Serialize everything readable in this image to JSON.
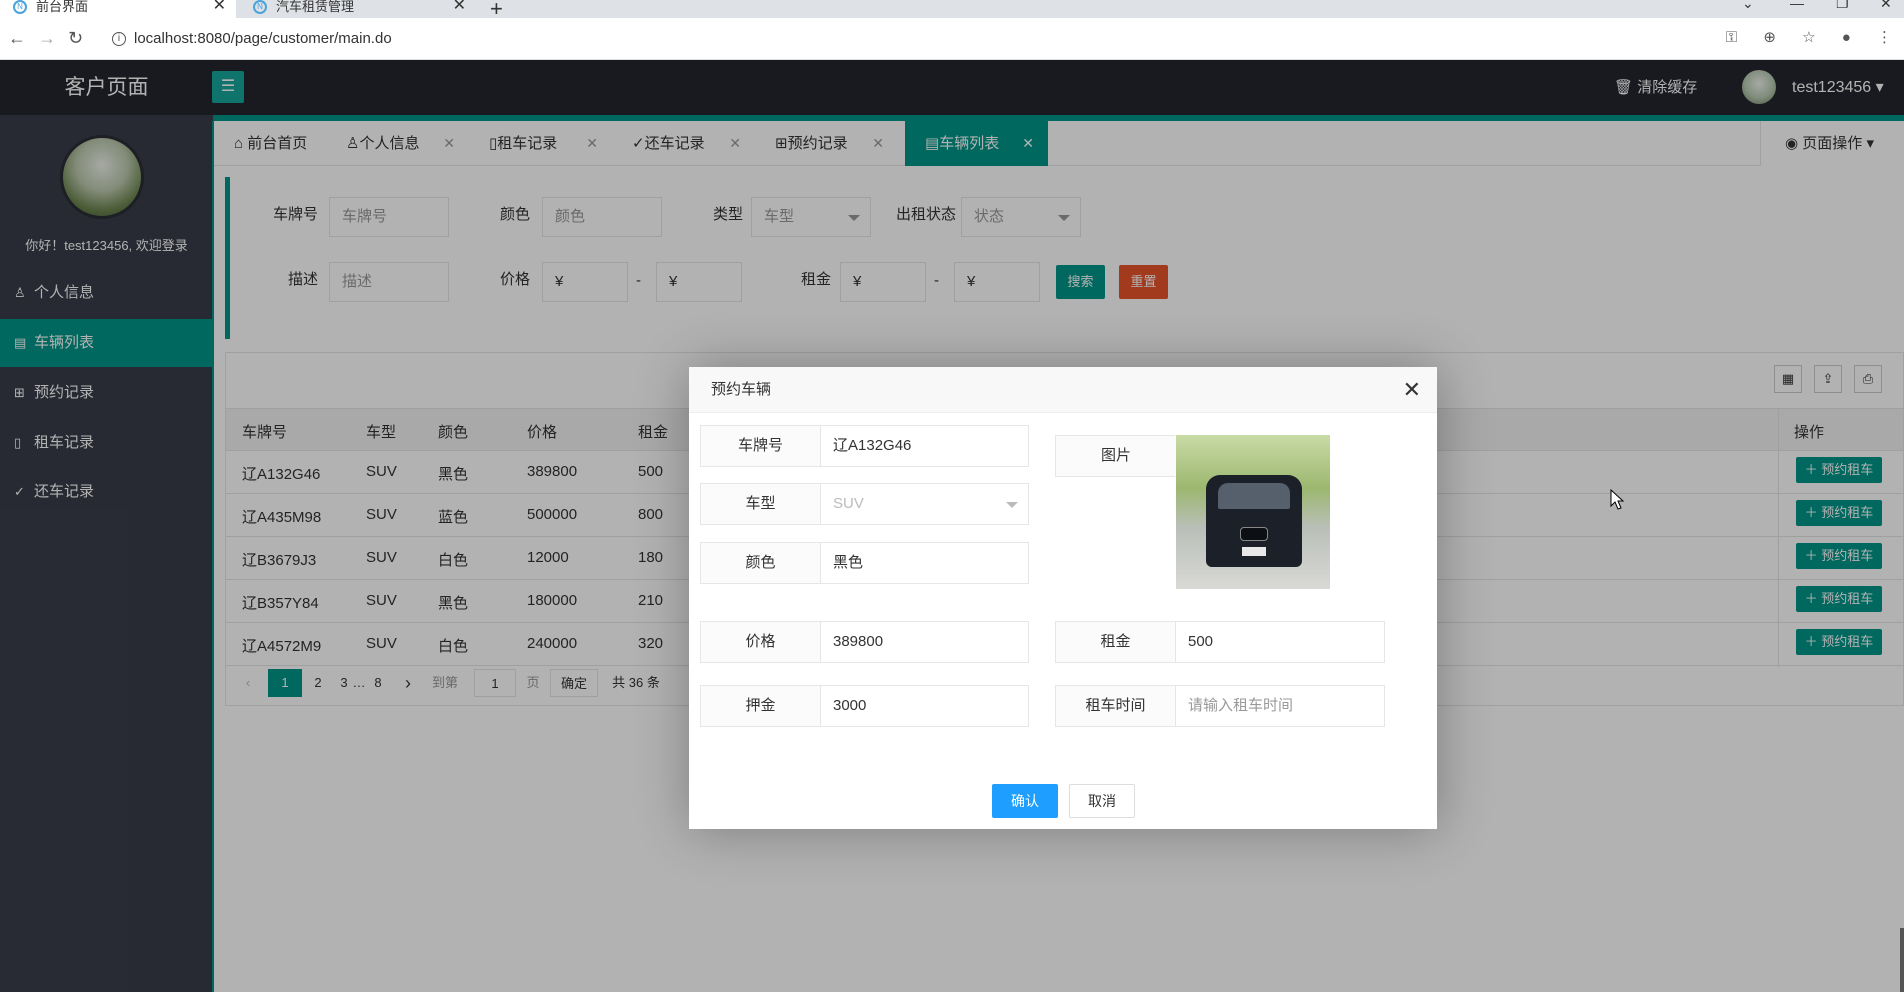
{
  "browser": {
    "tabs": [
      {
        "label": "前台界面",
        "active": true
      },
      {
        "label": "汽车租赁管理",
        "active": false
      }
    ],
    "url": "localhost:8080/page/customer/main.do"
  },
  "header": {
    "title": "客户页面",
    "menu_icon": "hamburger-icon",
    "clear_cache": "清除缓存",
    "username": "test123456"
  },
  "sidebar": {
    "greeting": "你好！test123456, 欢迎登录",
    "items": [
      {
        "label": "个人信息",
        "icon": "user-icon",
        "active": false
      },
      {
        "label": "车辆列表",
        "icon": "list-icon",
        "active": true
      },
      {
        "label": "预约记录",
        "icon": "book-icon",
        "active": false
      },
      {
        "label": "租车记录",
        "icon": "file-icon",
        "active": false
      },
      {
        "label": "还车记录",
        "icon": "check-circle-icon",
        "active": false
      }
    ]
  },
  "page_tabs": [
    {
      "label": "前台首页",
      "closable": false
    },
    {
      "label": "个人信息",
      "closable": true
    },
    {
      "label": "租车记录",
      "closable": true
    },
    {
      "label": "还车记录",
      "closable": true
    },
    {
      "label": "预约记录",
      "closable": true
    },
    {
      "label": "车辆列表",
      "closable": true,
      "active": true
    }
  ],
  "page_ops": "页面操作",
  "search": {
    "plate_label": "车牌号",
    "plate_placeholder": "车牌号",
    "color_label": "颜色",
    "color_placeholder": "颜色",
    "type_label": "类型",
    "type_placeholder": "车型",
    "status_label": "出租状态",
    "status_placeholder": "状态",
    "desc_label": "描述",
    "desc_placeholder": "描述",
    "price_label": "价格",
    "price_min": "¥",
    "price_max": "¥",
    "rent_label": "租金",
    "rent_min": "¥",
    "rent_max": "¥",
    "range_sep": "-",
    "search_button": "搜索",
    "reset_button": "重置"
  },
  "table": {
    "columns": [
      "车牌号",
      "车型",
      "颜色",
      "价格",
      "租金",
      "操作"
    ],
    "rows": [
      {
        "plate": "辽A132G46",
        "type": "SUV",
        "color": "黑色",
        "price": "389800",
        "rent": "500"
      },
      {
        "plate": "辽A435M98",
        "type": "SUV",
        "color": "蓝色",
        "price": "500000",
        "rent": "800"
      },
      {
        "plate": "辽B3679J3",
        "type": "SUV",
        "color": "白色",
        "price": "12000",
        "rent": "180"
      },
      {
        "plate": "辽B357Y84",
        "type": "SUV",
        "color": "黑色",
        "price": "180000",
        "rent": "210"
      },
      {
        "plate": "辽A4572M9",
        "type": "SUV",
        "color": "白色",
        "price": "240000",
        "rent": "320"
      }
    ],
    "row_action": "预约租车",
    "pager": {
      "pages": [
        "1",
        "2",
        "3",
        "…",
        "8"
      ],
      "goto_label": "到第",
      "goto_value": "1",
      "page_unit": "页",
      "confirm": "确定",
      "total": "共 36 条"
    }
  },
  "modal": {
    "title": "预约车辆",
    "fields": {
      "plate": {
        "label": "车牌号",
        "value": "辽A132G46"
      },
      "type": {
        "label": "车型",
        "value": "SUV"
      },
      "color": {
        "label": "颜色",
        "value": "黑色"
      },
      "image": {
        "label": "图片"
      },
      "price": {
        "label": "价格",
        "value": "389800"
      },
      "rent": {
        "label": "租金",
        "value": "500"
      },
      "deposit": {
        "label": "押金",
        "value": "3000"
      },
      "rent_time": {
        "label": "租车时间",
        "placeholder": "请输入租车时间"
      }
    },
    "confirm": "确认",
    "cancel": "取消"
  },
  "colors": {
    "accent": "#009688",
    "danger": "#e9532c",
    "primary": "#1e9fff",
    "header_bg": "#23262e",
    "sidebar_bg": "#393d49"
  }
}
